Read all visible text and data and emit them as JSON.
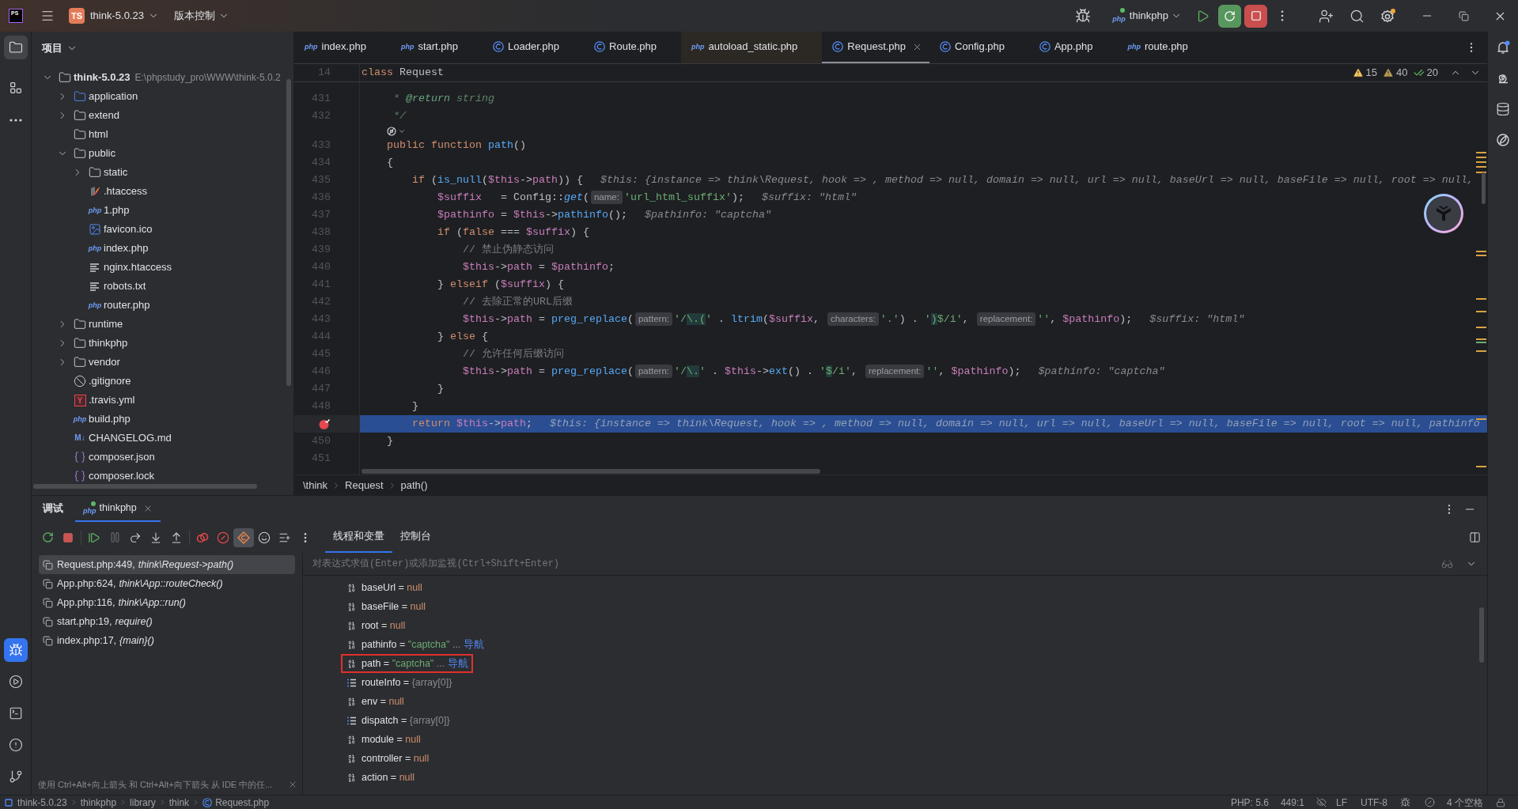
{
  "title_bar": {
    "logo": "PS",
    "project_badge": "TS",
    "project": "think-5.0.23",
    "vcs": "版本控制",
    "run_config_badge": "php",
    "run_config": "thinkphp"
  },
  "tool_strip": {
    "top": [
      {
        "kind": "project",
        "selected": true
      },
      {
        "kind": "structure",
        "selected": false
      },
      {
        "kind": "more",
        "selected": false
      }
    ],
    "bottom": [
      {
        "kind": "debug",
        "selected": true
      },
      {
        "kind": "run",
        "selected": false
      },
      {
        "kind": "terminal",
        "selected": false
      },
      {
        "kind": "problems",
        "selected": false
      },
      {
        "kind": "git",
        "selected": false
      }
    ]
  },
  "editor_tabs": [
    {
      "label": "index.php",
      "kind": "php",
      "badge": "php",
      "selected": false,
      "tinted": false
    },
    {
      "label": "start.php",
      "kind": "php",
      "badge": "php",
      "selected": false,
      "tinted": false
    },
    {
      "label": "Loader.php",
      "kind": "class",
      "selected": false,
      "tinted": false
    },
    {
      "label": "Route.php",
      "kind": "class",
      "selected": false,
      "tinted": false
    },
    {
      "label": "autoload_static.php",
      "kind": "php",
      "badge": "php",
      "selected": false,
      "tinted": true
    },
    {
      "label": "Request.php",
      "kind": "class",
      "selected": true,
      "tinted": false
    },
    {
      "label": "Config.php",
      "kind": "class",
      "selected": false,
      "tinted": false
    },
    {
      "label": "App.php",
      "kind": "class",
      "selected": false,
      "tinted": false
    },
    {
      "label": "route.php",
      "kind": "php",
      "badge": "php",
      "selected": false,
      "tinted": false
    }
  ],
  "project_panel": {
    "title": "项目",
    "tree": [
      {
        "name": "think-5.0.23",
        "path": "E:\\phpstudy_pro\\WWW\\think-5.0.2",
        "kind": "folder",
        "expanded": true,
        "children": [
          {
            "name": "application",
            "kind": "source-folder",
            "expanded": false
          },
          {
            "name": "extend",
            "kind": "folder",
            "expanded": false
          },
          {
            "name": "html",
            "kind": "folder"
          },
          {
            "name": "public",
            "kind": "folder",
            "expanded": true,
            "children": [
              {
                "name": "static",
                "kind": "folder",
                "expanded": false
              },
              {
                "name": ".htaccess",
                "kind": "htaccess"
              },
              {
                "name": "1.php",
                "kind": "php",
                "badge": "php"
              },
              {
                "name": "favicon.ico",
                "kind": "image"
              },
              {
                "name": "index.php",
                "kind": "php",
                "badge": "php"
              },
              {
                "name": "nginx.htaccess",
                "kind": "text"
              },
              {
                "name": "robots.txt",
                "kind": "text"
              },
              {
                "name": "router.php",
                "kind": "php",
                "badge": "php"
              }
            ]
          },
          {
            "name": "runtime",
            "kind": "folder",
            "expanded": false
          },
          {
            "name": "thinkphp",
            "kind": "folder",
            "expanded": false
          },
          {
            "name": "vendor",
            "kind": "folder",
            "expanded": false
          },
          {
            "name": ".gitignore",
            "kind": "ignore"
          },
          {
            "name": ".travis.yml",
            "kind": "yaml",
            "badge": "Y"
          },
          {
            "name": "build.php",
            "kind": "php",
            "badge": "php"
          },
          {
            "name": "CHANGELOG.md",
            "kind": "markdown",
            "badge": "M↓"
          },
          {
            "name": "composer.json",
            "kind": "json"
          },
          {
            "name": "composer.lock",
            "kind": "json"
          }
        ]
      }
    ]
  },
  "editor": {
    "sticky_line": {
      "number": "14",
      "parts": [
        {
          "kind": "code",
          "tokens": [
            {
              "kind": "kw",
              "text": "class"
            },
            {
              "kind": "plain",
              "text": " Request"
            }
          ]
        }
      ]
    },
    "inspections": [
      {
        "kind": "warning",
        "count": "15"
      },
      {
        "kind": "weak-warning",
        "count": "40"
      },
      {
        "kind": "typo",
        "count": "20"
      }
    ],
    "lines": [
      {
        "kind": "code",
        "number": "431",
        "current": false,
        "breakpoint": false,
        "parts": [
          {
            "kind": "code",
            "tokens": [
              {
                "kind": "doc",
                "text": "     * "
              },
              {
                "kind": "doctag",
                "text": "@return"
              },
              {
                "kind": "doc",
                "text": " string"
              }
            ]
          }
        ]
      },
      {
        "kind": "code",
        "number": "432",
        "current": false,
        "breakpoint": false,
        "parts": [
          {
            "kind": "code",
            "tokens": [
              {
                "kind": "doc",
                "text": "     */"
              }
            ]
          }
        ]
      },
      {
        "kind": "lens",
        "current": false,
        "breakpoint": false
      },
      {
        "kind": "code",
        "number": "433",
        "current": false,
        "breakpoint": false,
        "parts": [
          {
            "kind": "code",
            "tokens": [
              {
                "kind": "kw",
                "text": "    public function "
              },
              {
                "kind": "func",
                "text": "path"
              },
              {
                "kind": "plain",
                "text": "()"
              }
            ]
          }
        ]
      },
      {
        "kind": "code",
        "number": "434",
        "current": false,
        "breakpoint": false,
        "parts": [
          {
            "kind": "code",
            "tokens": [
              {
                "kind": "plain",
                "text": "    {"
              }
            ]
          }
        ]
      },
      {
        "kind": "code",
        "number": "435",
        "current": false,
        "breakpoint": false,
        "parts": [
          {
            "kind": "code",
            "tokens": [
              {
                "kind": "kw",
                "text": "        if"
              },
              {
                "kind": "plain",
                "text": " ("
              },
              {
                "kind": "func",
                "text": "is_null"
              },
              {
                "kind": "plain",
                "text": "("
              },
              {
                "kind": "var",
                "text": "$this"
              },
              {
                "kind": "plain",
                "text": "->"
              },
              {
                "kind": "field",
                "text": "path"
              },
              {
                "kind": "plain",
                "text": ")) {"
              }
            ]
          },
          {
            "kind": "value",
            "text": "$this: {instance => think\\Request, hook => , method => null, domain => null, url => null, baseUrl => null, baseFile => null, root => null,"
          }
        ]
      },
      {
        "kind": "code",
        "number": "436",
        "current": false,
        "breakpoint": false,
        "parts": [
          {
            "kind": "code",
            "tokens": [
              {
                "kind": "var",
                "text": "            $suffix"
              },
              {
                "kind": "plain",
                "text": "   = Config::"
              },
              {
                "kind": "sfunc",
                "text": "get"
              },
              {
                "kind": "plain",
                "text": "("
              }
            ]
          },
          {
            "kind": "hint",
            "text": "name:"
          },
          {
            "kind": "code",
            "tokens": [
              {
                "kind": "str",
                "text": "'url_html_suffix'"
              },
              {
                "kind": "plain",
                "text": ");"
              }
            ]
          },
          {
            "kind": "value",
            "text": "$suffix: \"html\""
          }
        ]
      },
      {
        "kind": "code",
        "number": "437",
        "current": false,
        "breakpoint": false,
        "parts": [
          {
            "kind": "code",
            "tokens": [
              {
                "kind": "var",
                "text": "            $pathinfo"
              },
              {
                "kind": "plain",
                "text": " = "
              },
              {
                "kind": "var",
                "text": "$this"
              },
              {
                "kind": "plain",
                "text": "->"
              },
              {
                "kind": "func",
                "text": "pathinfo"
              },
              {
                "kind": "plain",
                "text": "();"
              }
            ]
          },
          {
            "kind": "value",
            "text": "$pathinfo: \"captcha\""
          }
        ]
      },
      {
        "kind": "code",
        "number": "438",
        "current": false,
        "breakpoint": false,
        "parts": [
          {
            "kind": "code",
            "tokens": [
              {
                "kind": "kw",
                "text": "            if"
              },
              {
                "kind": "plain",
                "text": " ("
              },
              {
                "kind": "kw",
                "text": "false"
              },
              {
                "kind": "plain",
                "text": " === "
              },
              {
                "kind": "var",
                "text": "$suffix"
              },
              {
                "kind": "plain",
                "text": ") {"
              }
            ]
          }
        ]
      },
      {
        "kind": "code",
        "number": "439",
        "current": false,
        "breakpoint": false,
        "parts": [
          {
            "kind": "code",
            "tokens": [
              {
                "kind": "cmt",
                "text": "                // 禁止伪静态访问"
              }
            ]
          }
        ]
      },
      {
        "kind": "code",
        "number": "440",
        "current": false,
        "breakpoint": false,
        "parts": [
          {
            "kind": "code",
            "tokens": [
              {
                "kind": "var",
                "text": "                $this"
              },
              {
                "kind": "plain",
                "text": "->"
              },
              {
                "kind": "field",
                "text": "path"
              },
              {
                "kind": "plain",
                "text": " = "
              },
              {
                "kind": "var",
                "text": "$pathinfo"
              },
              {
                "kind": "plain",
                "text": ";"
              }
            ]
          }
        ]
      },
      {
        "kind": "code",
        "number": "441",
        "current": false,
        "breakpoint": false,
        "parts": [
          {
            "kind": "code",
            "tokens": [
              {
                "kind": "plain",
                "text": "            } "
              },
              {
                "kind": "kw",
                "text": "elseif"
              },
              {
                "kind": "plain",
                "text": " ("
              },
              {
                "kind": "var",
                "text": "$suffix"
              },
              {
                "kind": "plain",
                "text": ") {"
              }
            ]
          }
        ]
      },
      {
        "kind": "code",
        "number": "442",
        "current": false,
        "breakpoint": false,
        "parts": [
          {
            "kind": "code",
            "tokens": [
              {
                "kind": "cmt",
                "text": "                // 去除正常的URL后缀"
              }
            ]
          }
        ]
      },
      {
        "kind": "code",
        "number": "443",
        "current": false,
        "breakpoint": false,
        "parts": [
          {
            "kind": "code",
            "tokens": [
              {
                "kind": "var",
                "text": "                $this"
              },
              {
                "kind": "plain",
                "text": "->"
              },
              {
                "kind": "field",
                "text": "path"
              },
              {
                "kind": "plain",
                "text": " = "
              },
              {
                "kind": "func",
                "text": "preg_replace"
              },
              {
                "kind": "plain",
                "text": "("
              }
            ]
          },
          {
            "kind": "hint",
            "text": "pattern:"
          },
          {
            "kind": "code",
            "tokens": [
              {
                "kind": "str",
                "text": "'/"
              },
              {
                "kind": "rx",
                "text": "\\.("
              },
              {
                "kind": "str",
                "text": "'"
              },
              {
                "kind": "plain",
                "text": " . "
              },
              {
                "kind": "func",
                "text": "ltrim"
              },
              {
                "kind": "plain",
                "text": "("
              },
              {
                "kind": "var",
                "text": "$suffix"
              },
              {
                "kind": "plain",
                "text": ", "
              }
            ]
          },
          {
            "kind": "hint",
            "text": "characters:"
          },
          {
            "kind": "code",
            "tokens": [
              {
                "kind": "str",
                "text": "'.'"
              },
              {
                "kind": "plain",
                "text": ") . "
              },
              {
                "kind": "str",
                "text": "'"
              },
              {
                "kind": "rx",
                "text": ")"
              },
              {
                "kind": "str",
                "text": "$/i'"
              },
              {
                "kind": "plain",
                "text": ", "
              }
            ]
          },
          {
            "kind": "hint",
            "text": "replacement:"
          },
          {
            "kind": "code",
            "tokens": [
              {
                "kind": "str",
                "text": "''"
              },
              {
                "kind": "plain",
                "text": ", "
              },
              {
                "kind": "var",
                "text": "$pathinfo"
              },
              {
                "kind": "plain",
                "text": ");"
              }
            ]
          },
          {
            "kind": "value",
            "text": "$suffix: \"html\""
          }
        ]
      },
      {
        "kind": "code",
        "number": "444",
        "current": false,
        "breakpoint": false,
        "parts": [
          {
            "kind": "code",
            "tokens": [
              {
                "kind": "plain",
                "text": "            } "
              },
              {
                "kind": "kw",
                "text": "else"
              },
              {
                "kind": "plain",
                "text": " {"
              }
            ]
          }
        ]
      },
      {
        "kind": "code",
        "number": "445",
        "current": false,
        "breakpoint": false,
        "parts": [
          {
            "kind": "code",
            "tokens": [
              {
                "kind": "cmt",
                "text": "                // 允许任何后缀访问"
              }
            ]
          }
        ]
      },
      {
        "kind": "code",
        "number": "446",
        "current": false,
        "breakpoint": false,
        "parts": [
          {
            "kind": "code",
            "tokens": [
              {
                "kind": "var",
                "text": "                $this"
              },
              {
                "kind": "plain",
                "text": "->"
              },
              {
                "kind": "field",
                "text": "path"
              },
              {
                "kind": "plain",
                "text": " = "
              },
              {
                "kind": "func",
                "text": "preg_replace"
              },
              {
                "kind": "plain",
                "text": "("
              }
            ]
          },
          {
            "kind": "hint",
            "text": "pattern:"
          },
          {
            "kind": "code",
            "tokens": [
              {
                "kind": "str",
                "text": "'/"
              },
              {
                "kind": "rx",
                "text": "\\."
              },
              {
                "kind": "str",
                "text": "'"
              },
              {
                "kind": "plain",
                "text": " . "
              },
              {
                "kind": "var",
                "text": "$this"
              },
              {
                "kind": "plain",
                "text": "->"
              },
              {
                "kind": "func",
                "text": "ext"
              },
              {
                "kind": "plain",
                "text": "() . "
              },
              {
                "kind": "str",
                "text": "'"
              },
              {
                "kind": "rx",
                "text": "$"
              },
              {
                "kind": "str",
                "text": "/i'"
              },
              {
                "kind": "plain",
                "text": ", "
              }
            ]
          },
          {
            "kind": "hint",
            "text": "replacement:"
          },
          {
            "kind": "code",
            "tokens": [
              {
                "kind": "str",
                "text": "''"
              },
              {
                "kind": "plain",
                "text": ", "
              },
              {
                "kind": "var",
                "text": "$pathinfo"
              },
              {
                "kind": "plain",
                "text": ");"
              }
            ]
          },
          {
            "kind": "value",
            "text": "$pathinfo: \"captcha\""
          }
        ]
      },
      {
        "kind": "code",
        "number": "447",
        "current": false,
        "breakpoint": false,
        "parts": [
          {
            "kind": "code",
            "tokens": [
              {
                "kind": "plain",
                "text": "            }"
              }
            ]
          }
        ]
      },
      {
        "kind": "code",
        "number": "448",
        "current": false,
        "breakpoint": false,
        "parts": [
          {
            "kind": "code",
            "tokens": [
              {
                "kind": "plain",
                "text": "        }"
              }
            ]
          }
        ]
      },
      {
        "kind": "code",
        "current": true,
        "breakpoint": true,
        "parts": [
          {
            "kind": "code",
            "tokens": [
              {
                "kind": "kw",
                "text": "        return "
              },
              {
                "kind": "var",
                "text": "$this"
              },
              {
                "kind": "plain",
                "text": "->"
              },
              {
                "kind": "field",
                "text": "path"
              },
              {
                "kind": "plain",
                "text": ";"
              }
            ]
          },
          {
            "kind": "value",
            "text": "$this: {instance => think\\Request, hook => , method => null, domain => null, url => null, baseUrl => null, baseFile => null, root => null, pathinfo"
          }
        ]
      },
      {
        "kind": "code",
        "number": "450",
        "current": false,
        "breakpoint": false,
        "parts": [
          {
            "kind": "code",
            "tokens": [
              {
                "kind": "plain",
                "text": "    }"
              }
            ]
          }
        ]
      },
      {
        "kind": "code",
        "number": "451",
        "current": false,
        "breakpoint": false
      }
    ],
    "breadcrumb": [
      "\\think",
      "Request",
      "path()"
    ]
  },
  "debug": {
    "title": "调试",
    "session": {
      "badge": "php",
      "label": "thinkphp",
      "selected": true
    },
    "toolbar": [
      {
        "kind": "rerun",
        "on": false
      },
      {
        "kind": "stop",
        "on": false
      },
      {
        "kind": "resume",
        "on": false
      },
      {
        "kind": "pause",
        "on": false
      },
      {
        "kind": "step-over",
        "on": false
      },
      {
        "kind": "step-into",
        "on": false
      },
      {
        "kind": "step-out",
        "on": false
      },
      {
        "kind": "breakpoints",
        "on": false
      },
      {
        "kind": "mute",
        "on": false
      },
      {
        "kind": "target",
        "on": true
      },
      {
        "kind": "smile",
        "on": false
      },
      {
        "kind": "add",
        "on": false
      },
      {
        "kind": "more",
        "on": false
      }
    ],
    "views": [
      {
        "label": "线程和变量",
        "selected": true
      },
      {
        "label": "控制台",
        "selected": false
      }
    ],
    "frames": [
      {
        "location": "Request.php:449,",
        "method": "think\\Request->path()",
        "selected": true
      },
      {
        "location": "App.php:624,",
        "method": "think\\App::routeCheck()",
        "selected": false
      },
      {
        "location": "App.php:116,",
        "method": "think\\App::run()",
        "selected": false
      },
      {
        "location": "start.php:19,",
        "method": "require()",
        "selected": false
      },
      {
        "location": "index.php:17,",
        "method": "{main}()",
        "selected": false
      }
    ],
    "frames_hint": "使用 Ctrl+Alt+向上箭头 和 Ctrl+Alt+向下箭头 从 IDE 中的任...",
    "evaluate": {
      "placeholder": "对表达式求值(Enter)或添加监视(Ctrl+Shift+Enter)"
    },
    "variables": [
      {
        "name": "baseUrl",
        "op": "=",
        "value": "null",
        "kind": "null",
        "boxed": false
      },
      {
        "name": "baseFile",
        "op": "=",
        "value": "null",
        "kind": "null",
        "boxed": false
      },
      {
        "name": "root",
        "op": "=",
        "value": "null",
        "kind": "null",
        "boxed": false
      },
      {
        "name": "pathinfo",
        "op": "=",
        "value": "\"captcha\"",
        "kind": "string",
        "more": "...",
        "link": "导航",
        "boxed": false
      },
      {
        "name": "path",
        "op": "=",
        "value": "\"captcha\"",
        "kind": "string",
        "more": "...",
        "link": "导航",
        "boxed": true
      },
      {
        "name": "routeInfo",
        "op": "=",
        "value": "{array[0]}",
        "kind": "array",
        "boxed": false
      },
      {
        "name": "env",
        "op": "=",
        "value": "null",
        "kind": "null",
        "boxed": false
      },
      {
        "name": "dispatch",
        "op": "=",
        "value": "{array[0]}",
        "kind": "array",
        "boxed": false
      },
      {
        "name": "module",
        "op": "=",
        "value": "null",
        "kind": "null",
        "boxed": false
      },
      {
        "name": "controller",
        "op": "=",
        "value": "null",
        "kind": "null",
        "boxed": false
      },
      {
        "name": "action",
        "op": "=",
        "value": "null",
        "kind": "null",
        "boxed": false
      }
    ]
  },
  "status_bar": {
    "path": [
      {
        "label": "think-5.0.23",
        "kind": "project"
      },
      {
        "label": "thinkphp",
        "kind": "folder"
      },
      {
        "label": "library",
        "kind": "folder"
      },
      {
        "label": "think",
        "kind": "folder"
      },
      {
        "label": "Request.php",
        "kind": "class"
      }
    ],
    "items": [
      "PHP: 5.6",
      "449:1",
      "LF",
      "UTF-8",
      "4 个空格"
    ]
  }
}
